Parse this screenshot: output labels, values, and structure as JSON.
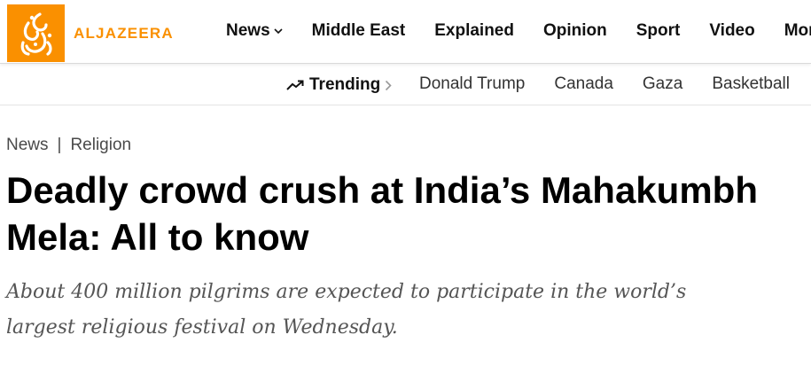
{
  "brand": {
    "wordmark": "ALJAZEERA",
    "color": "#fa9000",
    "icon": "aljazeera-calligraphy-logo-icon"
  },
  "nav": {
    "items": [
      {
        "label": "News",
        "has_dropdown": true
      },
      {
        "label": "Middle East"
      },
      {
        "label": "Explained"
      },
      {
        "label": "Opinion"
      },
      {
        "label": "Sport"
      },
      {
        "label": "Video"
      },
      {
        "label": "More"
      }
    ]
  },
  "trending": {
    "label": "Trending",
    "icon": "trending-arrow-icon",
    "links": [
      "Donald Trump",
      "Canada",
      "Gaza",
      "Basketball"
    ]
  },
  "breadcrumb": {
    "items": [
      "News",
      "Religion"
    ],
    "separator": "|"
  },
  "article": {
    "headline_line1": "Deadly crowd crush at India’s Mahakumbh",
    "headline_line2": "Mela: All to know",
    "dek_line1": "About 400 million pilgrims are expected to participate in the world’s",
    "dek_line2": "largest religious festival on Wednesday."
  }
}
